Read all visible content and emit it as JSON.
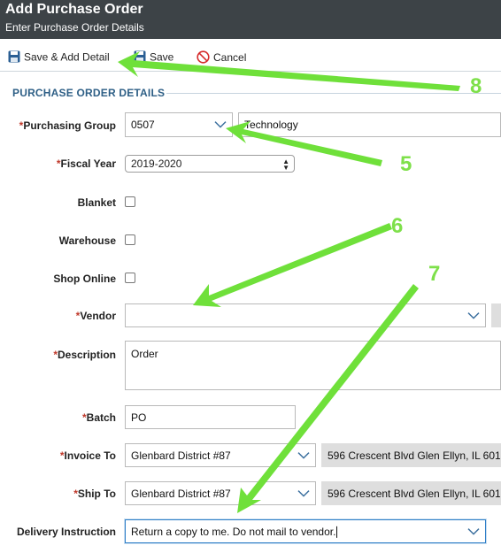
{
  "header": {
    "title": "Add Purchase Order",
    "subtitle": "Enter Purchase Order Details"
  },
  "toolbar": {
    "save_add_detail": "Save & Add Detail",
    "save": "Save",
    "cancel": "Cancel"
  },
  "section": {
    "title": "PURCHASE ORDER DETAILS"
  },
  "required_mark": "*",
  "fields": {
    "purchasing_group": {
      "label": "Purchasing Group",
      "code": "0507",
      "name": "Technology"
    },
    "fiscal_year": {
      "label": "Fiscal Year",
      "value": "2019-2020"
    },
    "blanket": {
      "label": "Blanket",
      "checked": false
    },
    "warehouse": {
      "label": "Warehouse",
      "checked": false
    },
    "shop_online": {
      "label": "Shop Online",
      "checked": false
    },
    "vendor": {
      "label": "Vendor",
      "value": ""
    },
    "description": {
      "label": "Description",
      "value": "Order"
    },
    "batch": {
      "label": "Batch",
      "value": "PO"
    },
    "invoice_to": {
      "label": "Invoice To",
      "value": "Glenbard District #87",
      "address": "596 Crescent Blvd Glen Ellyn, IL 601"
    },
    "ship_to": {
      "label": "Ship To",
      "value": "Glenbard District #87",
      "address": "596 Crescent Blvd Glen Ellyn, IL 601"
    },
    "delivery_instruction": {
      "label": "Delivery Instruction",
      "value": "Return a copy to me. Do not mail to vendor."
    }
  },
  "annotations": {
    "n8": "8",
    "n5": "5",
    "n6": "6",
    "n7": "7",
    "arrow_color": "#6fe03a"
  }
}
